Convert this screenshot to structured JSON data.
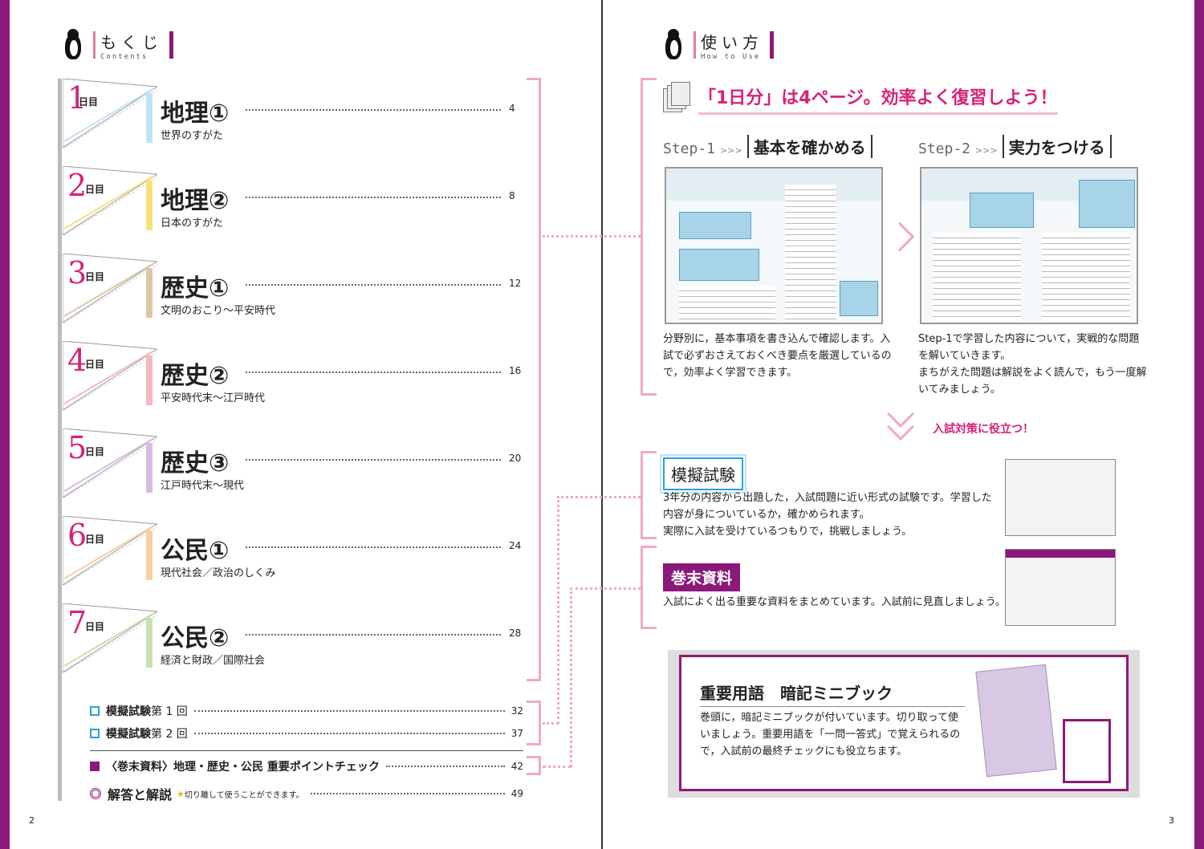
{
  "left": {
    "header": {
      "jp": "もくじ",
      "en": "Contents"
    },
    "days": [
      {
        "num": "1",
        "unit": "日目",
        "subject": "地理①",
        "desc": "世界のすがた",
        "page": "4",
        "color": "#bfe3f4"
      },
      {
        "num": "2",
        "unit": "日目",
        "subject": "地理②",
        "desc": "日本のすがた",
        "page": "8",
        "color": "#f5e07a"
      },
      {
        "num": "3",
        "unit": "日目",
        "subject": "歴史①",
        "desc": "文明のおこり～平安時代",
        "page": "12",
        "color": "#d9c8a8"
      },
      {
        "num": "4",
        "unit": "日目",
        "subject": "歴史②",
        "desc": "平安時代末～江戸時代",
        "page": "16",
        "color": "#f5b8c0"
      },
      {
        "num": "5",
        "unit": "日目",
        "subject": "歴史③",
        "desc": "江戸時代末～現代",
        "page": "20",
        "color": "#d8bce0"
      },
      {
        "num": "6",
        "unit": "日目",
        "subject": "公民①",
        "desc": "現代社会／政治のしくみ",
        "page": "24",
        "color": "#f8d0a0"
      },
      {
        "num": "7",
        "unit": "日目",
        "subject": "公民②",
        "desc": "経済と財政／国際社会",
        "page": "28",
        "color": "#c8e0b0"
      }
    ],
    "extras": [
      {
        "label": "模擬試験",
        "sub": " 第 1 回",
        "page": "32"
      },
      {
        "label": "模擬試験",
        "sub": " 第 2 回",
        "page": "37"
      }
    ],
    "kanmatsu": {
      "label": "〈巻末資料〉地理・歴史・公民 重要ポイントチェック",
      "page": "42"
    },
    "kaitou": {
      "label": "解答と解説",
      "note": "切り離して使うことができます。",
      "page": "49"
    },
    "page_number": "2"
  },
  "right": {
    "header": {
      "jp": "使い方",
      "en": "How to Use"
    },
    "headline": "「1日分」は4ページ。効率よく復習しよう！",
    "step1": {
      "step": "Step-1",
      "arrow": ">>>",
      "title": "基本を確かめる",
      "text": [
        "分野別に，基本事項を書き込んで確認します。入",
        "試で必ずおさえておくべき要点を厳選しているの",
        "で，効率よく学習できます。"
      ]
    },
    "step2": {
      "step": "Step-2",
      "arrow": ">>>",
      "title": "実力をつける",
      "text": [
        "Step-1で学習した内容について，実戦的な問題",
        "を解いていきます。",
        "まちがえた問題は解説をよく読んで，もう一度解",
        "いてみましょう。"
      ]
    },
    "useful": "入試対策に役立つ！",
    "moshi": {
      "title": "模擬試験",
      "text": [
        "3年分の内容から出題した，入試問題に近い形式の試験です。学習した",
        "内容が身についているか，確かめられます。",
        "実際に入試を受けているつもりで，挑戦しましょう。"
      ]
    },
    "kanmatsu": {
      "title": "巻末資料",
      "text": "入試によく出る重要な資料をまとめています。入試前に見直しましょう。"
    },
    "minibook": {
      "title": "重要用語　暗記ミニブック",
      "text": [
        "巻頭に，暗記ミニブックが付いています。切り取って使",
        "いましょう。重要用語を「一問一答式」で覚えられるの",
        "で，入試前の最終チェックにも役立ちます。"
      ]
    },
    "page_number": "3"
  }
}
